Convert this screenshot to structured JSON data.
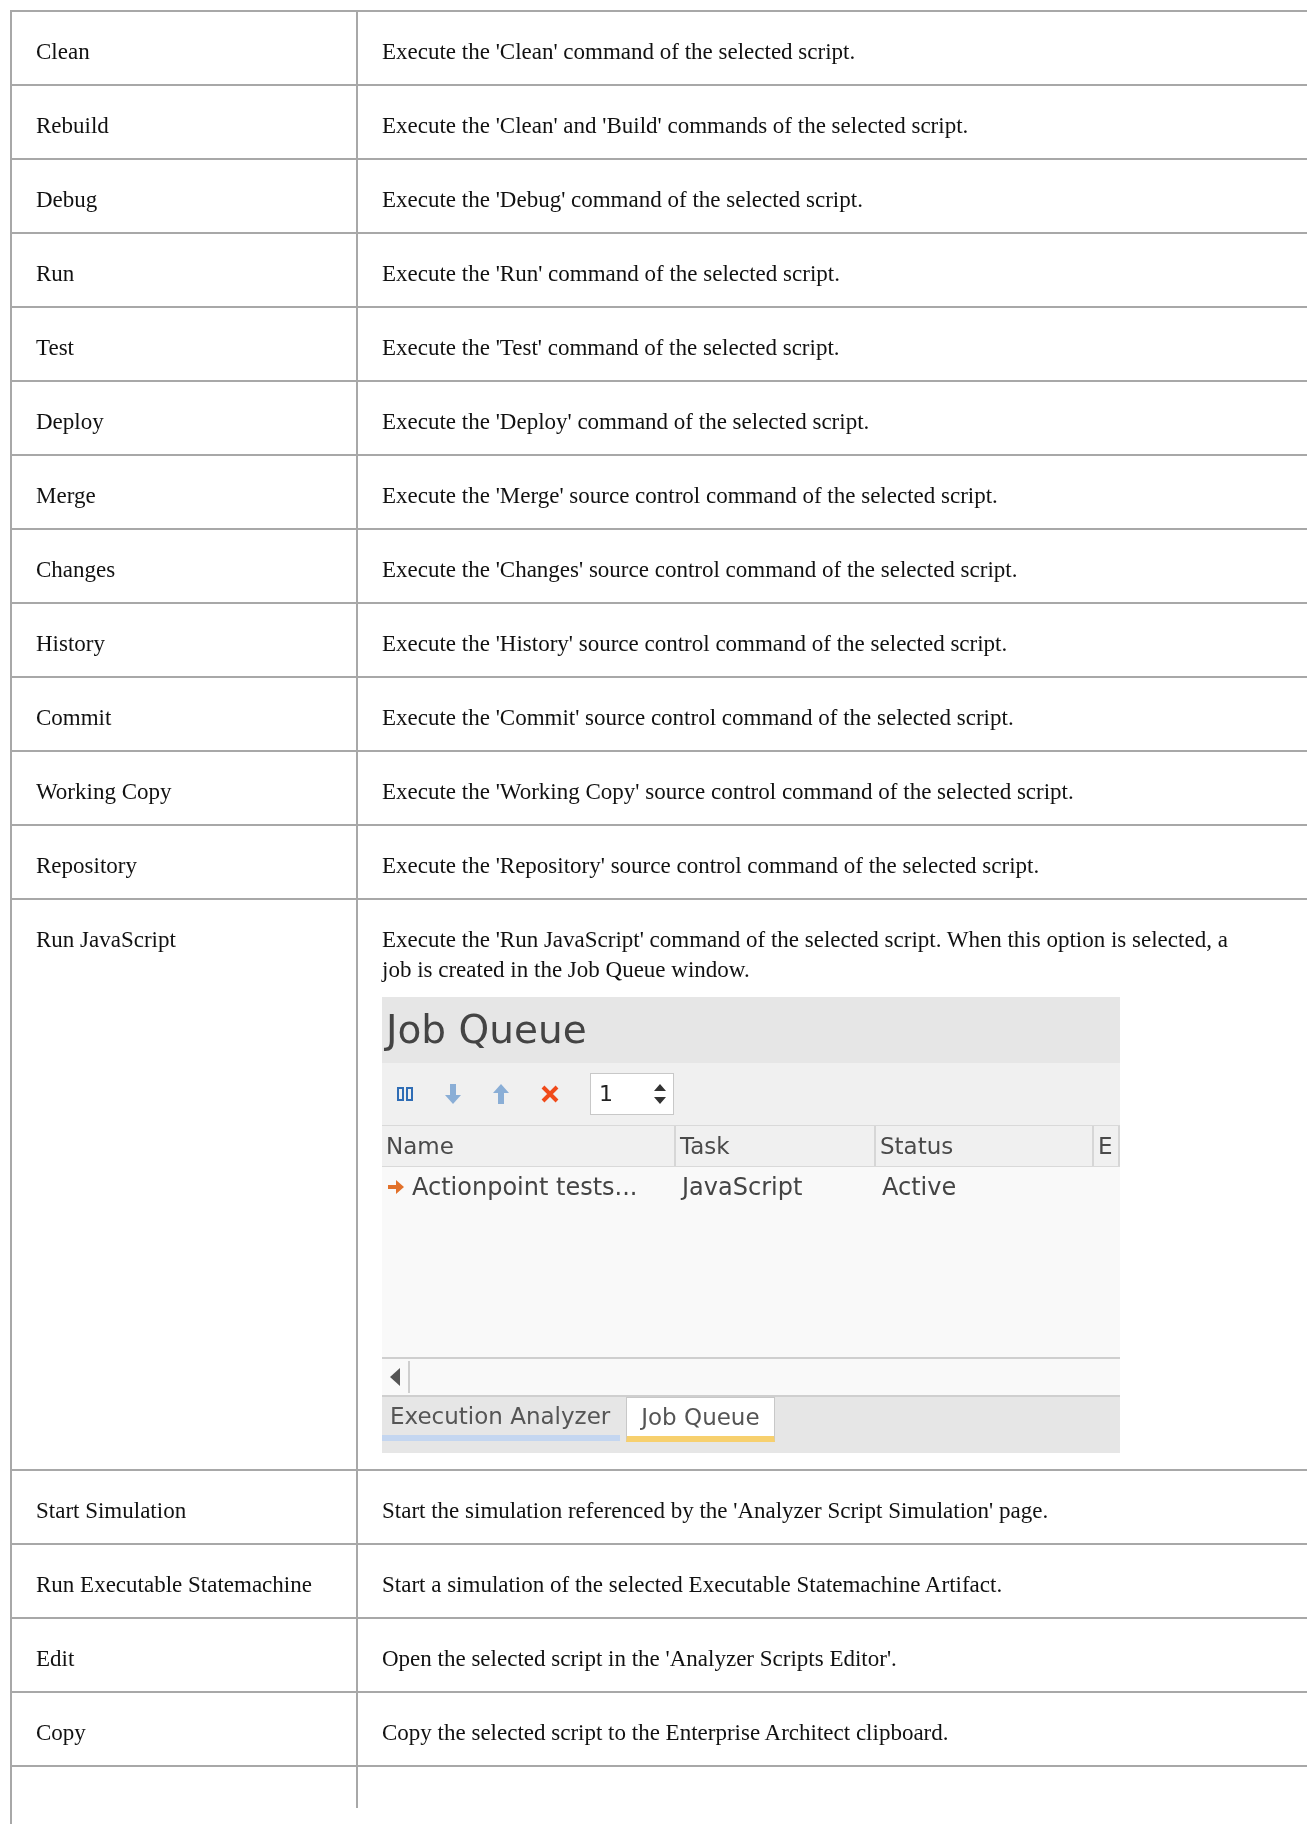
{
  "rows": [
    {
      "command": "Clean",
      "description": "Execute the 'Clean' command of the selected script."
    },
    {
      "command": "Rebuild",
      "description": "Execute the 'Clean' and 'Build' commands of the selected script."
    },
    {
      "command": "Debug",
      "description": "Execute the 'Debug' command of the selected script."
    },
    {
      "command": "Run",
      "description": "Execute the 'Run' command of the selected script."
    },
    {
      "command": "Test",
      "description": "Execute the 'Test' command of the selected script."
    },
    {
      "command": "Deploy",
      "description": "Execute the 'Deploy' command of the selected script."
    },
    {
      "command": "Merge",
      "description": "Execute the 'Merge' source control command of the selected script."
    },
    {
      "command": "Changes",
      "description": "Execute the 'Changes' source control command of the selected script."
    },
    {
      "command": "History",
      "description": "Execute the 'History' source control command of the selected script."
    },
    {
      "command": "Commit",
      "description": "Execute the 'Commit' source control command of the selected script."
    },
    {
      "command": "Working Copy",
      "description": "Execute the 'Working Copy' source control command of the selected script."
    },
    {
      "command": "Repository",
      "description": "Execute the 'Repository' source control command of the selected script."
    },
    {
      "command": "Run JavaScript",
      "description": "Execute the 'Run JavaScript' command of the selected script. When this option is selected, a job is created in the Job Queue window.",
      "job_queue": {
        "title": "Job Queue",
        "spin_value": "1",
        "columns": [
          "Name",
          "Task",
          "Status",
          "E"
        ],
        "jobs": [
          {
            "name": "Actionpoint tests...",
            "task": "JavaScript",
            "status": "Active"
          }
        ],
        "tabs": [
          {
            "label": "Execution Analyzer",
            "selected": false
          },
          {
            "label": "Job Queue",
            "selected": true
          }
        ]
      }
    },
    {
      "command": "Start Simulation",
      "description": "Start the simulation referenced by the 'Analyzer Script Simulation' page."
    },
    {
      "command": "Run Executable Statemachine",
      "description": "Start a simulation of the selected Executable Statemachine Artifact."
    },
    {
      "command": "Edit",
      "description": "Open the selected script in the 'Analyzer Scripts Editor'."
    },
    {
      "command": "Copy",
      "description": "Copy the selected script to the Enterprise Architect clipboard."
    }
  ]
}
